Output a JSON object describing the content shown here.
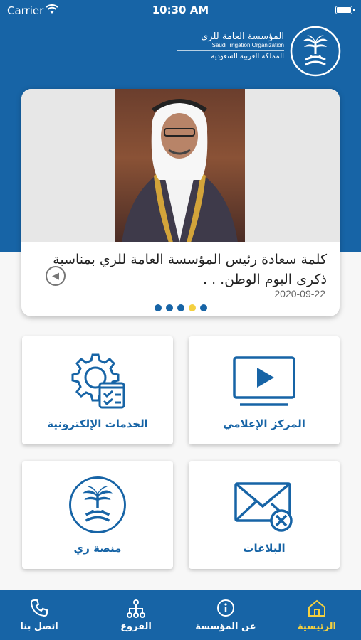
{
  "status_bar": {
    "carrier": "Carrier",
    "time": "10:30 AM"
  },
  "header": {
    "org_name_ar": "المؤسسة العامة للري",
    "org_name_en": "Saudi Irrigation Organization",
    "country_ar": "المملكة العربية السعودية"
  },
  "news": {
    "title": "كلمة سعادة رئيس المؤسسة العامة للري بمناسبة ذكرى اليوم الوطن. . .",
    "date": "2020-09-22",
    "slide_count": 5,
    "active_slide": 4
  },
  "tiles": {
    "eservices": "الخدمات الإلكترونية",
    "media_center": "المركز الإعلامي",
    "rai_platform": "منصة ري",
    "reports": "البلاغات"
  },
  "nav": {
    "contact": "اتصل بنا",
    "branches": "الفروع",
    "about": "عن المؤسسة",
    "home": "الرئيسية"
  },
  "colors": {
    "primary": "#1764a6",
    "accent": "#f4d03f"
  }
}
